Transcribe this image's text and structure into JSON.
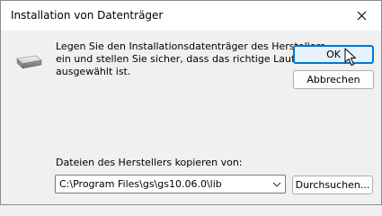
{
  "window": {
    "title": "Installation von Datenträger"
  },
  "message": {
    "lines": [
      "Legen Sie den Installationsdatenträger des Herstellers",
      "ein und stellen Sie sicher, dass das richtige Laufwerk",
      "ausgewählt ist."
    ]
  },
  "buttons": {
    "ok": "OK",
    "cancel": "Abbrechen",
    "browse": "Durchsuchen..."
  },
  "copy_from": {
    "label": "Dateien des Herstellers kopieren von:",
    "value": "C:\\Program Files\\gs\\gs10.06.0\\lib"
  },
  "icons": {
    "close": "close-icon",
    "drive": "disk-drive-icon",
    "dropdown": "chevron-down-icon",
    "cursor": "mouse-pointer-icon"
  },
  "colors": {
    "accent": "#0078d4",
    "ok_fill": "#e5f1fb",
    "dialog_bg": "#f0f0f0",
    "titlebar_bg": "#ffffff"
  }
}
